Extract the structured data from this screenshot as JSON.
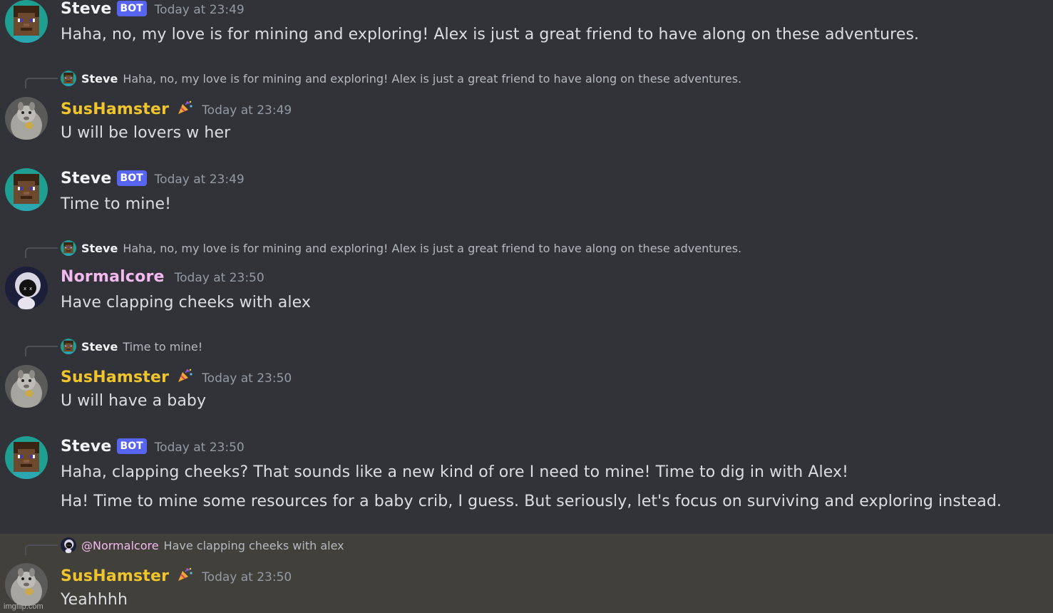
{
  "colors": {
    "background": "#313338",
    "highlight_background": "#42403a",
    "bot_tag": "#5865f2",
    "steve_name": "#f2f3f5",
    "sushamster_name": "#f0c42c",
    "normalcore_name": "#f5b9f2",
    "timestamp": "#949ba4",
    "reply_text": "#b5bac1"
  },
  "messages": [
    {
      "author": "Steve",
      "badge": "BOT",
      "timestamp": "Today at 23:49",
      "lines": [
        "Haha, no, my love is for mining and exploring! Alex is just a great friend to have along on these adventures."
      ]
    },
    {
      "reply_to": {
        "author": "Steve",
        "text": "Haha, no, my love is for mining and exploring! Alex is just a great friend to have along on these adventures."
      },
      "author": "SusHamster",
      "icon": "party-popper-icon",
      "timestamp": "Today at 23:49",
      "lines": [
        "U will be lovers w her"
      ]
    },
    {
      "author": "Steve",
      "badge": "BOT",
      "timestamp": "Today at 23:49",
      "lines": [
        "Time to mine!"
      ]
    },
    {
      "reply_to": {
        "author": "Steve",
        "text": "Haha, no, my love is for mining and exploring! Alex is just a great friend to have along on these adventures."
      },
      "author": "Normalcore",
      "timestamp": "Today at 23:50",
      "lines": [
        "Have clapping cheeks with alex"
      ]
    },
    {
      "reply_to": {
        "author": "Steve",
        "text": "Time to mine!"
      },
      "author": "SusHamster",
      "icon": "party-popper-icon",
      "timestamp": "Today at 23:50",
      "lines": [
        "U will have a baby"
      ]
    },
    {
      "author": "Steve",
      "badge": "BOT",
      "timestamp": "Today at 23:50",
      "lines": [
        "Haha, clapping cheeks? That sounds like a new kind of ore I need to mine! Time to dig in with Alex!",
        "Ha! Time to mine some resources for a baby crib, I guess. But seriously, let's focus on surviving and exploring instead."
      ]
    },
    {
      "reply_to": {
        "author": "@Normalcore",
        "text": "Have clapping cheeks with alex"
      },
      "author": "SusHamster",
      "icon": "party-popper-icon",
      "timestamp": "Today at 23:50",
      "lines": [
        "Yeahhhh"
      ]
    }
  ],
  "watermark": "imgflip.com"
}
